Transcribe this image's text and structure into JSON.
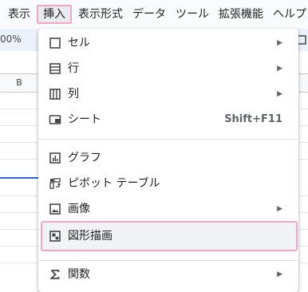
{
  "menubar": {
    "items": [
      {
        "label": "表示"
      },
      {
        "label": "挿入"
      },
      {
        "label": "表示形式"
      },
      {
        "label": "データ"
      },
      {
        "label": "ツール"
      },
      {
        "label": "拡張機能"
      },
      {
        "label": "ヘルプ"
      }
    ]
  },
  "toolbar": {
    "zoom": "00%"
  },
  "sheet": {
    "column_b": "B"
  },
  "insert_menu": {
    "items": [
      {
        "label": "セル",
        "icon": "cell-box-icon"
      },
      {
        "label": "行",
        "icon": "row-icon"
      },
      {
        "label": "列",
        "icon": "column-icon"
      },
      {
        "label": "シート",
        "icon": "sheet-icon",
        "shortcut": "Shift+F11"
      },
      {
        "label": "グラフ",
        "icon": "chart-icon"
      },
      {
        "label": "ピボット テーブル",
        "icon": "pivot-table-icon"
      },
      {
        "label": "画像",
        "icon": "image-icon"
      },
      {
        "label": "図形描画",
        "icon": "drawing-icon"
      },
      {
        "label": "関数",
        "icon": "sigma-icon"
      }
    ],
    "highlighted": "図形描画"
  },
  "colors": {
    "highlight_border": "#f2a5c6",
    "menubar_bg": "#f9fbfd",
    "selection_blue": "#2b66d4"
  }
}
